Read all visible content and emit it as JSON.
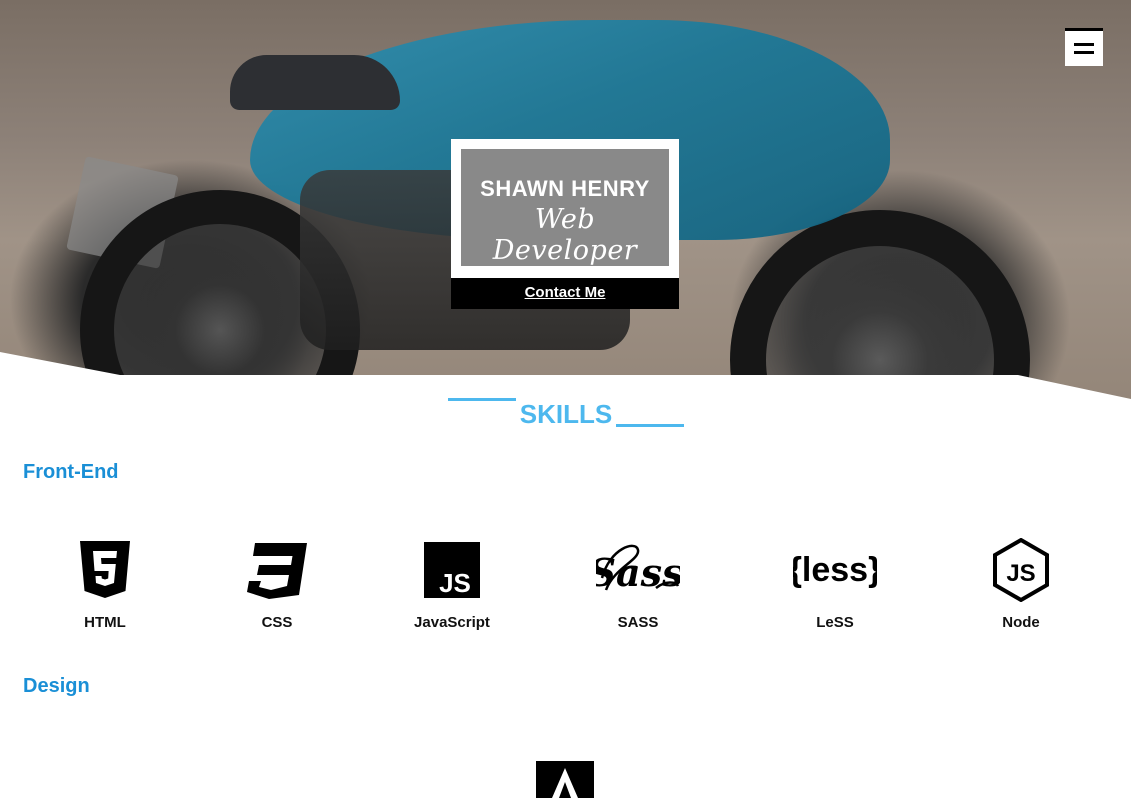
{
  "hero": {
    "name": "SHAWN HENRY",
    "role": "Web Developer",
    "contact_label": "Contact Me"
  },
  "menu": {
    "icon": "hamburger-menu-icon"
  },
  "skills": {
    "heading": "SKILLS",
    "accent_color": "#4db8ee",
    "sections": [
      {
        "title": "Front-End",
        "items": [
          {
            "label": "HTML",
            "icon": "html5-icon"
          },
          {
            "label": "CSS",
            "icon": "css3-icon"
          },
          {
            "label": "JavaScript",
            "icon": "javascript-icon"
          },
          {
            "label": "SASS",
            "icon": "sass-icon"
          },
          {
            "label": "LeSS",
            "icon": "less-icon"
          },
          {
            "label": "Node",
            "icon": "nodejs-icon"
          }
        ]
      },
      {
        "title": "Design",
        "items": [
          {
            "label": "",
            "icon": "adobe-icon"
          }
        ]
      }
    ]
  }
}
